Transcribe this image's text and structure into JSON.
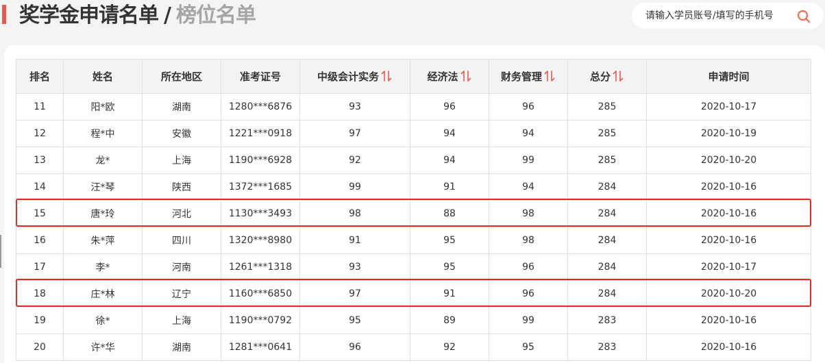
{
  "header": {
    "title_main": "奖学金申请名单",
    "title_separator": "/",
    "title_sub": "榜位名单",
    "accent_color": "#e85a4f"
  },
  "search": {
    "placeholder": "请输入学员账号/填写的手机号",
    "icon": "search-icon",
    "icon_color": "#ef6f54"
  },
  "table": {
    "columns": [
      {
        "label": "排名",
        "sortable": false
      },
      {
        "label": "姓名",
        "sortable": false
      },
      {
        "label": "所在地区",
        "sortable": false
      },
      {
        "label": "准考证号",
        "sortable": false
      },
      {
        "label": "中级会计实务",
        "sortable": true
      },
      {
        "label": "经济法",
        "sortable": true
      },
      {
        "label": "财务管理",
        "sortable": true
      },
      {
        "label": "总分",
        "sortable": true
      },
      {
        "label": "申请时间",
        "sortable": false
      }
    ],
    "rows": [
      {
        "rank": "11",
        "name": "阳*欧",
        "region": "湖南",
        "exam_id": "1280***6876",
        "accounting": "93",
        "economic_law": "96",
        "finance": "96",
        "total": "285",
        "date": "2020-10-17",
        "highlighted": false
      },
      {
        "rank": "12",
        "name": "程*中",
        "region": "安徽",
        "exam_id": "1221***0918",
        "accounting": "97",
        "economic_law": "94",
        "finance": "94",
        "total": "285",
        "date": "2020-10-19",
        "highlighted": false
      },
      {
        "rank": "13",
        "name": "龙*",
        "region": "上海",
        "exam_id": "1190***6928",
        "accounting": "92",
        "economic_law": "94",
        "finance": "99",
        "total": "285",
        "date": "2020-10-20",
        "highlighted": false
      },
      {
        "rank": "14",
        "name": "汪*琴",
        "region": "陕西",
        "exam_id": "1372***1685",
        "accounting": "99",
        "economic_law": "91",
        "finance": "94",
        "total": "284",
        "date": "2020-10-16",
        "highlighted": false
      },
      {
        "rank": "15",
        "name": "唐*玲",
        "region": "河北",
        "exam_id": "1130***3493",
        "accounting": "98",
        "economic_law": "88",
        "finance": "98",
        "total": "284",
        "date": "2020-10-16",
        "highlighted": true
      },
      {
        "rank": "16",
        "name": "朱*萍",
        "region": "四川",
        "exam_id": "1320***8980",
        "accounting": "91",
        "economic_law": "95",
        "finance": "98",
        "total": "284",
        "date": "2020-10-16",
        "highlighted": false
      },
      {
        "rank": "17",
        "name": "李*",
        "region": "河南",
        "exam_id": "1261***1318",
        "accounting": "93",
        "economic_law": "95",
        "finance": "96",
        "total": "284",
        "date": "2020-10-17",
        "highlighted": false
      },
      {
        "rank": "18",
        "name": "庄*林",
        "region": "辽宁",
        "exam_id": "1160***6850",
        "accounting": "97",
        "economic_law": "91",
        "finance": "96",
        "total": "284",
        "date": "2020-10-20",
        "highlighted": true
      },
      {
        "rank": "19",
        "name": "徐*",
        "region": "上海",
        "exam_id": "1190***0792",
        "accounting": "95",
        "economic_law": "89",
        "finance": "99",
        "total": "283",
        "date": "2020-10-16",
        "highlighted": false
      },
      {
        "rank": "20",
        "name": "许*华",
        "region": "湖南",
        "exam_id": "1281***0641",
        "accounting": "96",
        "economic_law": "92",
        "finance": "95",
        "total": "283",
        "date": "2020-10-16",
        "highlighted": false
      }
    ],
    "sort_icon": "sort-arrows-icon",
    "sort_icon_color": "#e85a4f",
    "highlight_color": "#e02b22"
  }
}
